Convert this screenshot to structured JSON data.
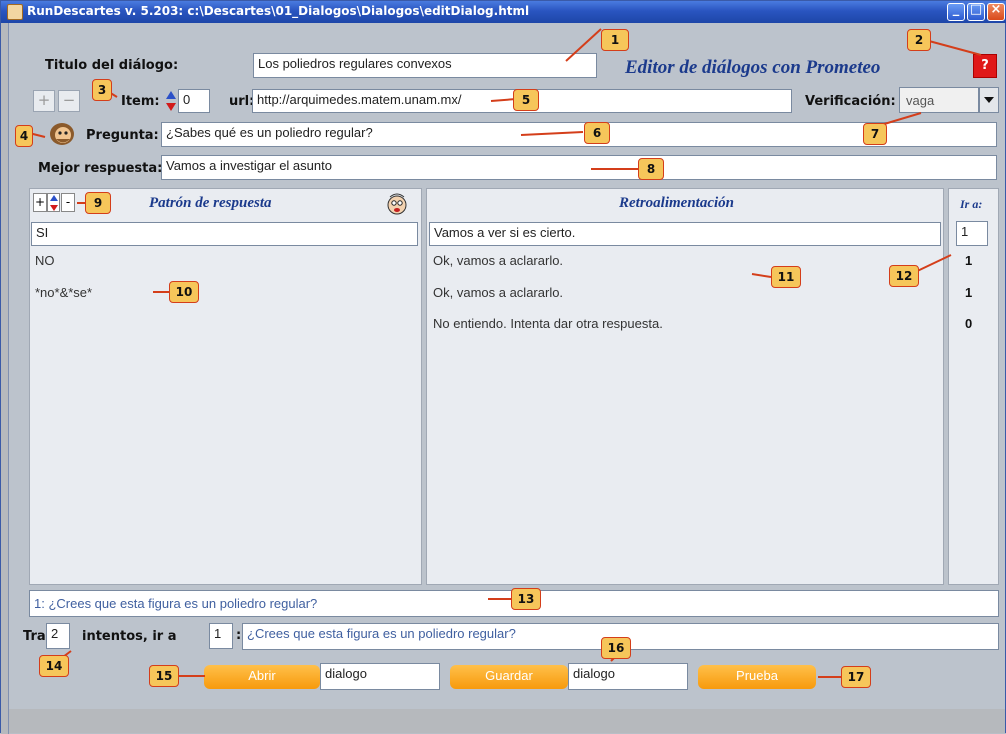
{
  "window": {
    "title": "RunDescartes  v. 5.203: c:\\Descartes\\01_Dialogos\\Dialogos\\editDialog.html"
  },
  "header": {
    "dialog_title_label": "Titulo del diálogo:",
    "dialog_title_value": "Los poliedros regulares convexos",
    "editor_title": "Editor de diálogos con Prometeo",
    "help_label": "?"
  },
  "item_row": {
    "add_label": "+",
    "remove_label": "−",
    "item_label": "Item:",
    "item_value": "0",
    "url_label": "url:",
    "url_value": "http://arquimedes.matem.unam.mx/",
    "verification_label": "Verificación:",
    "verification_value": "vaga"
  },
  "question": {
    "label": "Pregunta:",
    "value": "¿Sabes qué es un poliedro regular?"
  },
  "best_answer": {
    "label": "Mejor respuesta:",
    "value": "Vamos a investigar el asunto"
  },
  "patterns": {
    "header": "Patrón de respuesta",
    "rows": [
      "SI",
      "NO",
      "*no*&*se*"
    ]
  },
  "feedback": {
    "header": "Retroalimentación",
    "rows": [
      "Vamos a ver si es cierto.",
      "Ok, vamos a aclararlo.",
      "Ok, vamos a aclararlo.",
      "No entiendo. Intenta dar otra respuesta."
    ]
  },
  "goto": {
    "header": "Ir a:",
    "rows": [
      "1",
      "1",
      "1",
      "0"
    ]
  },
  "next_question": "1: ¿Crees que esta figura es un poliedro regular?",
  "attempts": {
    "tras_label": "Tras",
    "tries_value": "2",
    "mid_label": "intentos, ir a",
    "goto_value": "1",
    "colon": ":",
    "goto_text": "¿Crees que esta figura es un poliedro regular?"
  },
  "footer": {
    "open_label": "Abrir",
    "open_file": "dialogo",
    "save_label": "Guardar",
    "save_file": "dialogo",
    "test_label": "Prueba"
  },
  "callouts": [
    "1",
    "2",
    "3",
    "4",
    "5",
    "6",
    "7",
    "8",
    "9",
    "10",
    "11",
    "12",
    "13",
    "14",
    "15",
    "16",
    "17"
  ],
  "colors": {
    "callout_fill": "#f6c65a",
    "callout_border": "#d43e1a",
    "button_orange": "#f79a0c",
    "heading_blue": "#1b3a8c",
    "help_red": "#e01818"
  }
}
